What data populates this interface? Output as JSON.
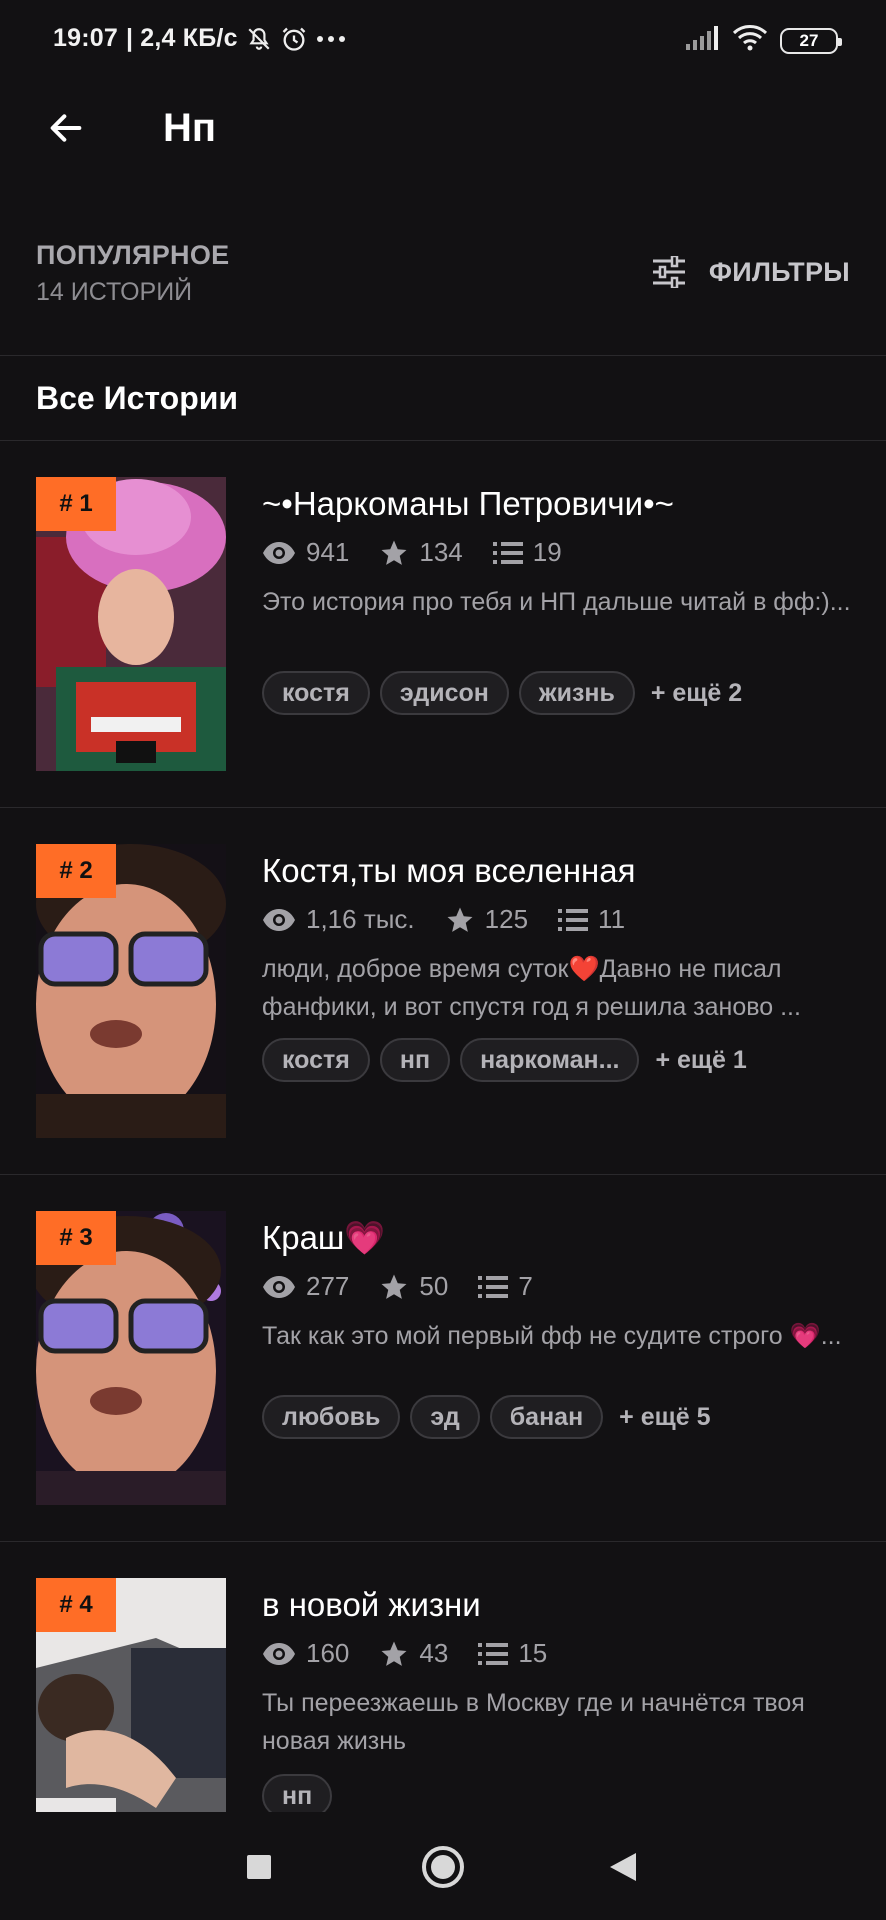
{
  "status": {
    "time": "19:07",
    "speed": "| 2,4 КБ/с",
    "battery": "27",
    "icons": [
      "bell-off-icon",
      "alarm-icon",
      "more-dots-icon",
      "signal-icon",
      "wifi-icon",
      "battery-icon"
    ]
  },
  "app_bar": {
    "title": "Нп",
    "back_icon": "arrow-left-icon"
  },
  "sort": {
    "title": "ПОПУЛЯРНОЕ",
    "count": "14 ИСТОРИЙ",
    "filters_label": "ФИЛЬТРЫ",
    "filters_icon": "sliders-icon"
  },
  "section": {
    "title": "Все Истории"
  },
  "stories": [
    {
      "rank": "# 1",
      "title": "~•Наркоманы Петровичи•~",
      "views": "941",
      "stars": "134",
      "parts": "19",
      "description": "Это история про тебя и НП дальше читай в фф:)...",
      "tags": [
        "костя",
        "эдисон",
        "жизнь"
      ],
      "more": "+ ещё 2"
    },
    {
      "rank": "# 2",
      "title": "Костя,ты моя вселенная",
      "views": "1,16 тыс.",
      "stars": "125",
      "parts": "11",
      "description": "люди, доброе время суток❤️Давно не писал фанфики, и вот спустя год я решила заново ...",
      "tags": [
        "костя",
        "нп",
        "наркоман..."
      ],
      "more": "+ ещё 1"
    },
    {
      "rank": "# 3",
      "title": "Краш💗",
      "views": "277",
      "stars": "50",
      "parts": "7",
      "description": "Так как это мой первый фф не судите строго 💗...",
      "tags": [
        "любовь",
        "эд",
        "банан"
      ],
      "more": "+ ещё 5"
    },
    {
      "rank": "# 4",
      "title": "в новой жизни",
      "views": "160",
      "stars": "43",
      "parts": "15",
      "description": "Ты переезжаешь в Москву где и начнётся твоя новая жизнь",
      "tags": [
        "нп"
      ],
      "more": ""
    }
  ],
  "nav": {
    "icons": [
      "recents-square-icon",
      "home-circle-icon",
      "back-triangle-icon"
    ]
  },
  "colors": {
    "background": "#121113",
    "accent": "#ff6d26",
    "muted_text": "#a3a2a7",
    "divider": "#2a292c"
  }
}
